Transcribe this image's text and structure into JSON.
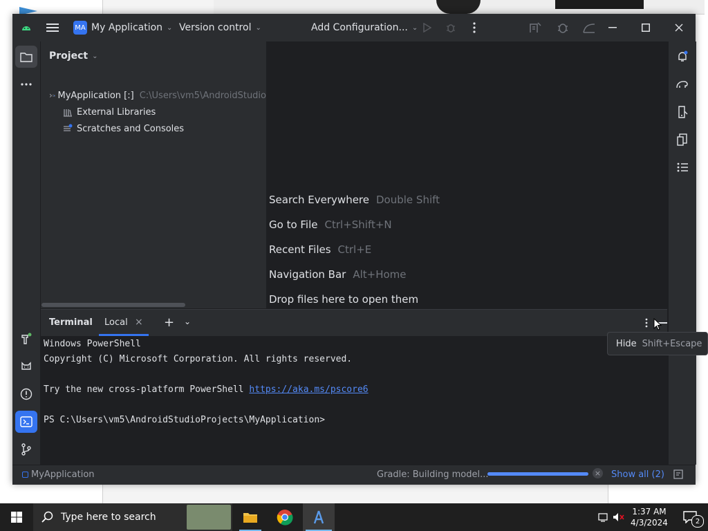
{
  "window": {
    "project_badge": "MA",
    "project_name": "My Application",
    "vcs_label": "Version control",
    "run_config_label": "Add Configuration..."
  },
  "project_panel": {
    "title": "Project",
    "tree": [
      {
        "label": "MyApplication [:]",
        "path": "C:\\Users\\vm5\\AndroidStudio"
      },
      {
        "label": "External Libraries"
      },
      {
        "label": "Scratches and Consoles"
      }
    ]
  },
  "editor_hints": [
    {
      "action": "Search Everywhere",
      "shortcut": "Double Shift"
    },
    {
      "action": "Go to File",
      "shortcut": "Ctrl+Shift+N"
    },
    {
      "action": "Recent Files",
      "shortcut": "Ctrl+E"
    },
    {
      "action": "Navigation Bar",
      "shortcut": "Alt+Home"
    },
    {
      "action": "Drop files here to open them",
      "shortcut": ""
    }
  ],
  "terminal": {
    "title": "Terminal",
    "tab_label": "Local",
    "lines": {
      "l1": "Windows PowerShell",
      "l2": "Copyright (C) Microsoft Corporation. All rights reserved.",
      "l3_prefix": "Try the new cross-platform PowerShell ",
      "l3_link": "https://aka.ms/pscore6",
      "l4": "PS C:\\Users\\vm5\\AndroidStudioProjects\\MyApplication>"
    }
  },
  "tooltip": {
    "label": "Hide",
    "shortcut": "Shift+Escape"
  },
  "statusbar": {
    "project": "MyApplication",
    "task": "Gradle: Building model...",
    "progress_fraction": 1.0,
    "show_all": "Show all (2)"
  },
  "taskbar": {
    "search_placeholder": "Type here to search",
    "time": "1:37 AM",
    "date": "4/3/2024",
    "notification_count": "2"
  },
  "colors": {
    "accent": "#3574f0",
    "link": "#548af7",
    "panel": "#2b2d30",
    "editor": "#1e1f22"
  }
}
